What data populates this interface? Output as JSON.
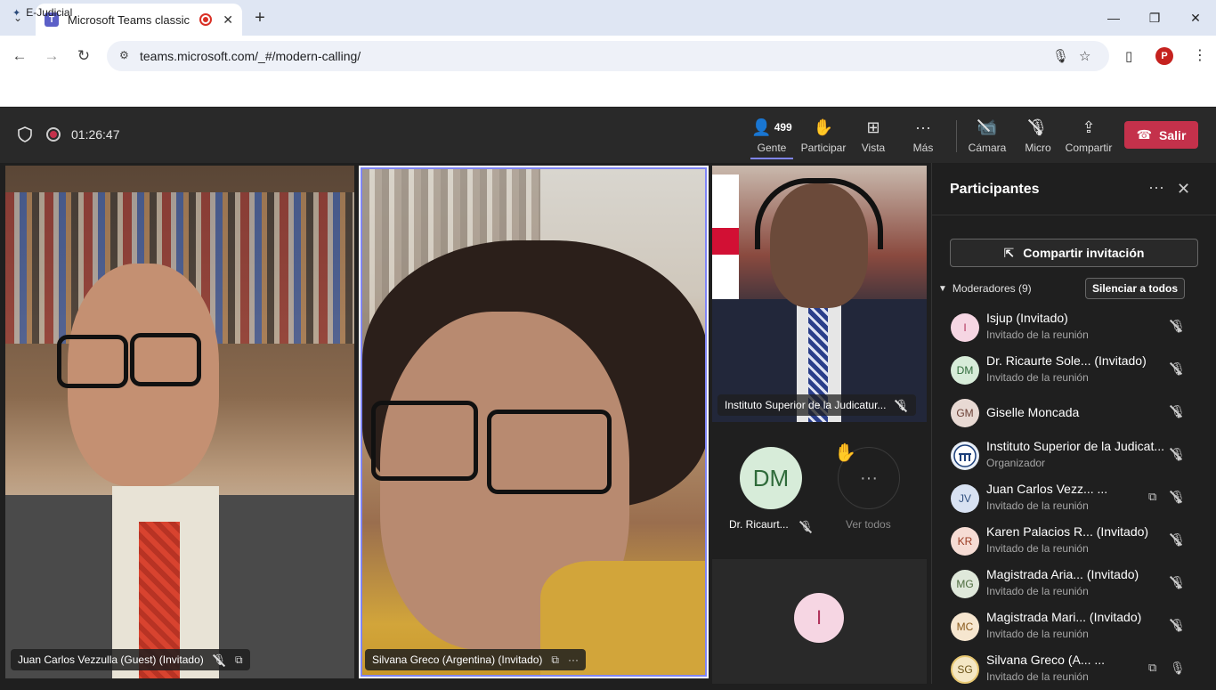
{
  "browser": {
    "tab_title": "Microsoft Teams classic",
    "url": "teams.microsoft.com/_#/modern-calling/",
    "bookmark": "E-Judicial",
    "profile_initial": "P"
  },
  "meeting": {
    "timer": "01:26:47",
    "toolbar": {
      "people_count": "499",
      "people_label": "Gente",
      "raise_label": "Participar",
      "view_label": "Vista",
      "more_label": "Más",
      "camera_label": "Cámara",
      "mic_label": "Micro",
      "share_label": "Compartir",
      "leave_label": "Salir"
    },
    "tiles": {
      "left_name": "Juan Carlos Vezzulla (Guest) (Invitado)",
      "center_name": "Silvana Greco (Argentina) (Invitado)",
      "right_top_name": "Instituto Superior de la Judicatur...",
      "mini_dm_initials": "DM",
      "mini_dm_name": "Dr. Ricaurt...",
      "ver_todos": "Ver todos",
      "bottom_initial": "I"
    }
  },
  "panel": {
    "title": "Participantes",
    "share_invite": "Compartir invitación",
    "moderators": "Moderadores (9)",
    "mute_all": "Silenciar a todos",
    "participants": [
      {
        "initials": "I",
        "name": "Isjup (Invitado)",
        "role": "Invitado de la reunión",
        "bg": "#f6d6e3",
        "fg": "#b0325a"
      },
      {
        "initials": "DM",
        "name": "Dr. Ricaurte Sole... (Invitado)",
        "role": "Invitado de la reunión",
        "bg": "#d7ecd9",
        "fg": "#2f6b3a"
      },
      {
        "initials": "GM",
        "name": "Giselle Moncada",
        "role": "",
        "bg": "#e8d9d3",
        "fg": "#6b4036"
      },
      {
        "initials": "",
        "name": "Instituto Superior de la Judicat...",
        "role": "Organizador",
        "bg": "#e8eef6",
        "fg": "#1c3f7a"
      },
      {
        "initials": "JV",
        "name": "Juan Carlos Vezz... ...",
        "role": "Invitado de la reunión",
        "bg": "#d8e2f2",
        "fg": "#30507f"
      },
      {
        "initials": "KR",
        "name": "Karen Palacios R... (Invitado)",
        "role": "Invitado de la reunión",
        "bg": "#f6dcd4",
        "fg": "#9c3b22"
      },
      {
        "initials": "MG",
        "name": "Magistrada Aria... (Invitado)",
        "role": "Invitado de la reunión",
        "bg": "#dfe8da",
        "fg": "#4c6b3d"
      },
      {
        "initials": "MC",
        "name": "Magistrada Mari... (Invitado)",
        "role": "Invitado de la reunión",
        "bg": "#f6e6cf",
        "fg": "#8a5a1c"
      },
      {
        "initials": "SG",
        "name": "Silvana Greco (A... ...",
        "role": "Invitado de la reunión",
        "bg": "#f4e7c4",
        "fg": "#6b5418"
      }
    ]
  }
}
